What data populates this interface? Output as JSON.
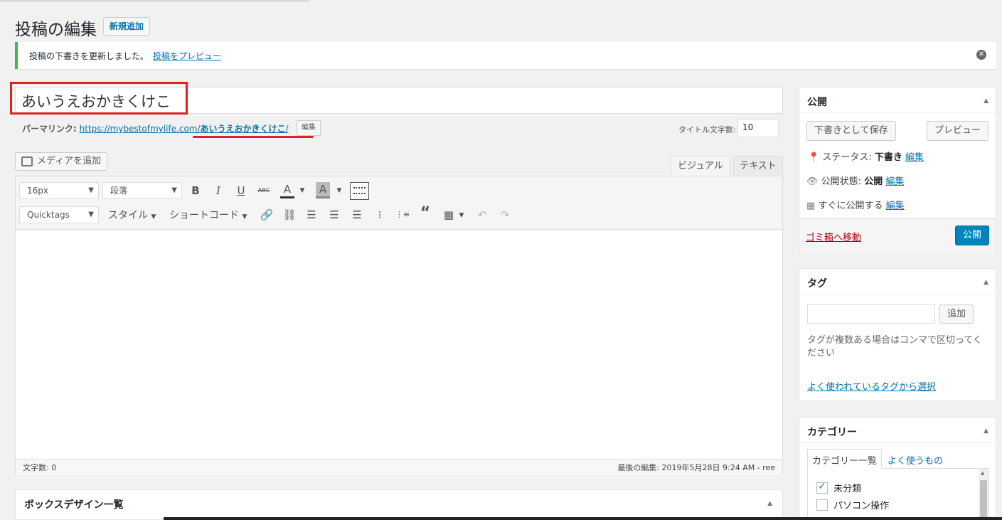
{
  "header": {
    "title": "投稿の編集",
    "add_new": "新規追加"
  },
  "notice": {
    "message": "投稿の下書きを更新しました。",
    "link": "投稿をプレビュー"
  },
  "post": {
    "title": "あいうえおかきくけこ",
    "permalink_label": "パーマリンク:",
    "permalink_base": "https://mybestofmylife.com/",
    "permalink_slug": "あいうえおかきくけこ",
    "permalink_trail": "/",
    "permalink_edit": "編集",
    "title_count_label": "タイトル文字数:",
    "title_count": "10"
  },
  "editor": {
    "add_media": "メディアを追加",
    "tab_visual": "ビジュアル",
    "tab_text": "テキスト",
    "font_size": "16px",
    "format": "段落",
    "quicktags": "Quicktags",
    "style": "スタイル",
    "shortcode": "ショートコード",
    "word_count": "文字数: 0",
    "last_edit": "最後の編集: 2019年5月28日 9:24 AM - ree"
  },
  "box_design": {
    "title": "ボックスデザイン一覧"
  },
  "publish": {
    "title": "公開",
    "save_draft": "下書きとして保存",
    "preview": "プレビュー",
    "status_label": "ステータス:",
    "status_value": "下書き",
    "visibility_label": "公開状態:",
    "visibility_value": "公開",
    "schedule_label": "すぐに公開する",
    "edit": "編集",
    "trash": "ゴミ箱へ移動",
    "publish_button": "公開"
  },
  "tags": {
    "title": "タグ",
    "add_button": "追加",
    "input_value": "",
    "hint": "タグが複数ある場合はコンマで区切ってください",
    "popular_link": "よく使われているタグから選択"
  },
  "categories": {
    "title": "カテゴリー",
    "tab_all": "カテゴリー一覧",
    "tab_popular": "よく使うもの",
    "items": [
      {
        "label": "未分類",
        "checked": true
      },
      {
        "label": "パソコン操作",
        "checked": false
      }
    ]
  },
  "colors": {
    "accent": "#0073aa",
    "primary_button": "#0085ba",
    "highlight": "#e0201a",
    "notice_success": "#46b450"
  }
}
